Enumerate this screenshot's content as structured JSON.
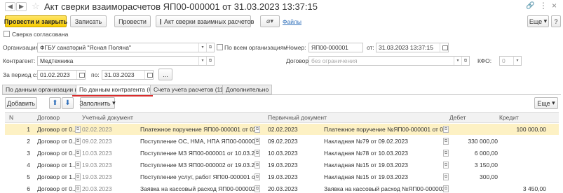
{
  "window": {
    "title": "Акт сверки взаиморасчетов ЯП00-000001 от 31.03.2023 13:37:15"
  },
  "toolbar": {
    "post_close": "Провести и закрыть",
    "write": "Записать",
    "post": "Провести",
    "act_report": "Акт сверки взаимных расчетов",
    "files": "Файлы",
    "more": "Еще",
    "help": "?"
  },
  "agreed": {
    "label": "Сверка согласована"
  },
  "form": {
    "org_label": "Организация:",
    "org_value": "ФГБУ санаторий \"Ясная Поляна\"",
    "all_orgs_label": "По всем организациям",
    "number_label": "Номер:",
    "number_value": "ЯП00-000001",
    "date_label": "от:",
    "date_value": "31.03.2023 13:37:15",
    "kontragent_label": "Контрагент:",
    "kontragent_value": "Медтехника",
    "dogovor_label": "Договор:",
    "dogovor_placeholder": "без ограничения",
    "kfo_label": "КФО:",
    "kfo_value": "0",
    "period_label": "За период с:",
    "period_from": "01.02.2023",
    "period_to_label": "по:",
    "period_to": "31.03.2023",
    "period_btn": "..."
  },
  "tabs": [
    "По данным организации (6)",
    "По данным контрагента (6)",
    "Счета учета расчетов (11)",
    "Дополнительно"
  ],
  "table_toolbar": {
    "add": "Добавить",
    "fill": "Заполнить",
    "more": "Еще"
  },
  "columns": {
    "n": "N",
    "dogovor": "Договор",
    "uchet": "Учетный документ",
    "perv": "Первичный документ",
    "debet": "Дебет",
    "kredit": "Кредит"
  },
  "rows": [
    {
      "n": "1",
      "dogovor": "Договор от 0...",
      "uchet_date": "02.02.2023",
      "uchet_doc": "Платежное поручение ЯП00-000001 от 02.02...",
      "perv_date": "02.02.2023",
      "perv_doc": "Платежное поручение №ЯП00-000001 от 02.02....",
      "debet": "",
      "kredit": "100 000,00",
      "selected": true
    },
    {
      "n": "2",
      "dogovor": "Договор от 0...",
      "uchet_date": "09.02.2023",
      "uchet_doc": "Поступление ОС, НМА, НПА ЯП00-000001 от...",
      "perv_date": "09.02.2023",
      "perv_doc": "Накладная №79 от 09.02.2023",
      "debet": "330 000,00",
      "kredit": "",
      "selected": false
    },
    {
      "n": "3",
      "dogovor": "Договор от 0...",
      "uchet_date": "10.03.2023",
      "uchet_doc": "Поступление МЗ ЯП00-000001 от 10.03.2023 ...",
      "perv_date": "10.03.2023",
      "perv_doc": "Накладная №78 от 10.03.2023",
      "debet": "6 000,00",
      "kredit": "",
      "selected": false
    },
    {
      "n": "4",
      "dogovor": "Договор от 1...",
      "uchet_date": "19.03.2023",
      "uchet_doc": "Поступление МЗ ЯП00-000002 от 19.03.2023 ...",
      "perv_date": "19.03.2023",
      "perv_doc": "Накладная №15 от 19.03.2023",
      "debet": "3 150,00",
      "kredit": "",
      "selected": false
    },
    {
      "n": "5",
      "dogovor": "Договор от 1...",
      "uchet_date": "19.03.2023",
      "uchet_doc": "Поступление услуг, работ ЯП00-000001 от 19...",
      "perv_date": "19.03.2023",
      "perv_doc": "Накладная №15 от 19.03.2023",
      "debet": "300,00",
      "kredit": "",
      "selected": false
    },
    {
      "n": "6",
      "dogovor": "Договор от 0...",
      "uchet_date": "20.03.2023",
      "uchet_doc": "Заявка на кассовый расход ЯП00-000002 от ...",
      "perv_date": "20.03.2023",
      "perv_doc": "Заявка на кассовый расход №ЯП00-000002 от ...",
      "debet": "",
      "kredit": "3 450,00",
      "selected": false
    }
  ],
  "colors": {
    "accent_yellow": "#f7cb00",
    "selection": "#fdf1c4",
    "tab_underline": "#d92c2c",
    "link": "#2f6fba"
  }
}
